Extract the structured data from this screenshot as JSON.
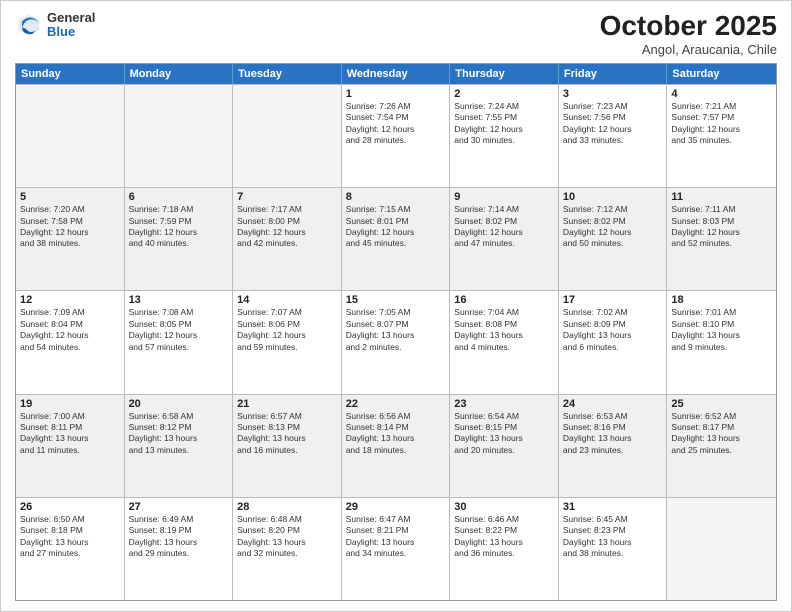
{
  "header": {
    "logo_general": "General",
    "logo_blue": "Blue",
    "month_title": "October 2025",
    "subtitle": "Angol, Araucania, Chile"
  },
  "weekdays": [
    "Sunday",
    "Monday",
    "Tuesday",
    "Wednesday",
    "Thursday",
    "Friday",
    "Saturday"
  ],
  "rows": [
    [
      {
        "day": "",
        "info": ""
      },
      {
        "day": "",
        "info": ""
      },
      {
        "day": "",
        "info": ""
      },
      {
        "day": "1",
        "info": "Sunrise: 7:26 AM\nSunset: 7:54 PM\nDaylight: 12 hours\nand 28 minutes."
      },
      {
        "day": "2",
        "info": "Sunrise: 7:24 AM\nSunset: 7:55 PM\nDaylight: 12 hours\nand 30 minutes."
      },
      {
        "day": "3",
        "info": "Sunrise: 7:23 AM\nSunset: 7:56 PM\nDaylight: 12 hours\nand 33 minutes."
      },
      {
        "day": "4",
        "info": "Sunrise: 7:21 AM\nSunset: 7:57 PM\nDaylight: 12 hours\nand 35 minutes."
      }
    ],
    [
      {
        "day": "5",
        "info": "Sunrise: 7:20 AM\nSunset: 7:58 PM\nDaylight: 12 hours\nand 38 minutes."
      },
      {
        "day": "6",
        "info": "Sunrise: 7:18 AM\nSunset: 7:59 PM\nDaylight: 12 hours\nand 40 minutes."
      },
      {
        "day": "7",
        "info": "Sunrise: 7:17 AM\nSunset: 8:00 PM\nDaylight: 12 hours\nand 42 minutes."
      },
      {
        "day": "8",
        "info": "Sunrise: 7:15 AM\nSunset: 8:01 PM\nDaylight: 12 hours\nand 45 minutes."
      },
      {
        "day": "9",
        "info": "Sunrise: 7:14 AM\nSunset: 8:02 PM\nDaylight: 12 hours\nand 47 minutes."
      },
      {
        "day": "10",
        "info": "Sunrise: 7:12 AM\nSunset: 8:02 PM\nDaylight: 12 hours\nand 50 minutes."
      },
      {
        "day": "11",
        "info": "Sunrise: 7:11 AM\nSunset: 8:03 PM\nDaylight: 12 hours\nand 52 minutes."
      }
    ],
    [
      {
        "day": "12",
        "info": "Sunrise: 7:09 AM\nSunset: 8:04 PM\nDaylight: 12 hours\nand 54 minutes."
      },
      {
        "day": "13",
        "info": "Sunrise: 7:08 AM\nSunset: 8:05 PM\nDaylight: 12 hours\nand 57 minutes."
      },
      {
        "day": "14",
        "info": "Sunrise: 7:07 AM\nSunset: 8:06 PM\nDaylight: 12 hours\nand 59 minutes."
      },
      {
        "day": "15",
        "info": "Sunrise: 7:05 AM\nSunset: 8:07 PM\nDaylight: 13 hours\nand 2 minutes."
      },
      {
        "day": "16",
        "info": "Sunrise: 7:04 AM\nSunset: 8:08 PM\nDaylight: 13 hours\nand 4 minutes."
      },
      {
        "day": "17",
        "info": "Sunrise: 7:02 AM\nSunset: 8:09 PM\nDaylight: 13 hours\nand 6 minutes."
      },
      {
        "day": "18",
        "info": "Sunrise: 7:01 AM\nSunset: 8:10 PM\nDaylight: 13 hours\nand 9 minutes."
      }
    ],
    [
      {
        "day": "19",
        "info": "Sunrise: 7:00 AM\nSunset: 8:11 PM\nDaylight: 13 hours\nand 11 minutes."
      },
      {
        "day": "20",
        "info": "Sunrise: 6:58 AM\nSunset: 8:12 PM\nDaylight: 13 hours\nand 13 minutes."
      },
      {
        "day": "21",
        "info": "Sunrise: 6:57 AM\nSunset: 8:13 PM\nDaylight: 13 hours\nand 16 minutes."
      },
      {
        "day": "22",
        "info": "Sunrise: 6:56 AM\nSunset: 8:14 PM\nDaylight: 13 hours\nand 18 minutes."
      },
      {
        "day": "23",
        "info": "Sunrise: 6:54 AM\nSunset: 8:15 PM\nDaylight: 13 hours\nand 20 minutes."
      },
      {
        "day": "24",
        "info": "Sunrise: 6:53 AM\nSunset: 8:16 PM\nDaylight: 13 hours\nand 23 minutes."
      },
      {
        "day": "25",
        "info": "Sunrise: 6:52 AM\nSunset: 8:17 PM\nDaylight: 13 hours\nand 25 minutes."
      }
    ],
    [
      {
        "day": "26",
        "info": "Sunrise: 6:50 AM\nSunset: 8:18 PM\nDaylight: 13 hours\nand 27 minutes."
      },
      {
        "day": "27",
        "info": "Sunrise: 6:49 AM\nSunset: 8:19 PM\nDaylight: 13 hours\nand 29 minutes."
      },
      {
        "day": "28",
        "info": "Sunrise: 6:48 AM\nSunset: 8:20 PM\nDaylight: 13 hours\nand 32 minutes."
      },
      {
        "day": "29",
        "info": "Sunrise: 6:47 AM\nSunset: 8:21 PM\nDaylight: 13 hours\nand 34 minutes."
      },
      {
        "day": "30",
        "info": "Sunrise: 6:46 AM\nSunset: 8:22 PM\nDaylight: 13 hours\nand 36 minutes."
      },
      {
        "day": "31",
        "info": "Sunrise: 6:45 AM\nSunset: 8:23 PM\nDaylight: 13 hours\nand 38 minutes."
      },
      {
        "day": "",
        "info": ""
      }
    ]
  ]
}
